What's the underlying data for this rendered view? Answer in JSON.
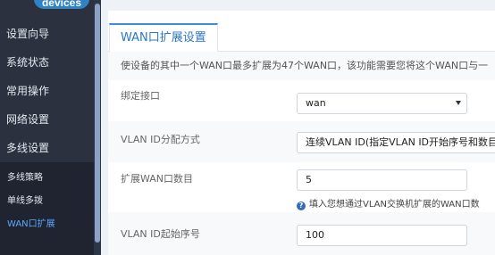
{
  "sidebar": {
    "logo": "devices",
    "items": [
      {
        "label": "设置向导"
      },
      {
        "label": "系统状态"
      },
      {
        "label": "常用操作"
      },
      {
        "label": "网络设置"
      },
      {
        "label": "多线设置"
      }
    ],
    "subitems": [
      {
        "label": "多线策略"
      },
      {
        "label": "单线多拨"
      },
      {
        "label": "WAN口扩展",
        "active": true
      }
    ]
  },
  "main": {
    "tab": "WAN口扩展设置",
    "description": "使设备的其中一个WAN口最多扩展为47个WAN口，该功能需要您将这个WAN口与一",
    "fields": {
      "bind_interface": {
        "label": "绑定接口",
        "value": "wan"
      },
      "vlan_id_mode": {
        "label": "VLAN ID分配方式",
        "value": "连续VLAN ID(指定VLAN ID开始序号和数目"
      },
      "wan_count": {
        "label": "扩展WAN口数目",
        "value": "5",
        "hint": "填入您想通过VLAN交换机扩展的WAN口数"
      },
      "vlan_start": {
        "label": "VLAN ID起始序号",
        "value": "100"
      }
    }
  },
  "colors": {
    "sidebar_bg": "#2c3140",
    "submenu_bg": "#1f2430",
    "accent": "#3c8dde",
    "active_link": "#5ba9ff"
  },
  "icons": {
    "hint": "question-circle-icon",
    "dropdown": "caret-down-icon"
  }
}
